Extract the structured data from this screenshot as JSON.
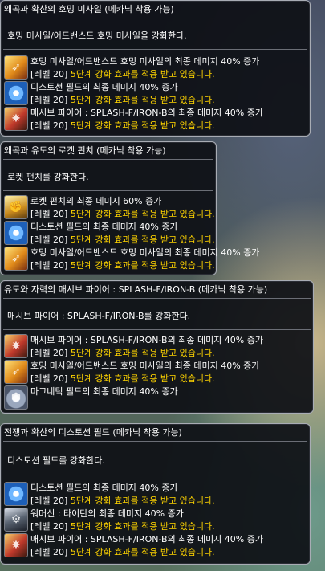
{
  "tooltips": [
    {
      "title": "왜곡과 확산의 호밍 미사일 (메카닉 착용 가능)",
      "desc": "호밍 미사일/어드밴스드 호밍 미사일을 강화한다.",
      "rows": [
        {
          "icon": "homing-missile-icon",
          "text": "호밍 미사일/어드밴스드 호밍 미사일의 최종 데미지 40% 증가",
          "level": "[레벨 20]",
          "note": " 5단계 강화 효과를 적용 받고 있습니다."
        },
        {
          "icon": "distortion-field-icon",
          "text": "디스토션 필드의 최종 데미지 40% 증가",
          "level": "[레벨 20]",
          "note": " 5단계 강화 효과를 적용 받고 있습니다."
        },
        {
          "icon": "massive-fire-icon",
          "text": "매시브 파이어 : SPLASH-F/IRON-B의 최종 데미지 40% 증가",
          "level": "[레벨 20]",
          "note": " 5단계 강화 효과를 적용 받고 있습니다."
        }
      ]
    },
    {
      "title": "왜곡과 유도의 로켓 펀치 (메카닉 착용 가능)",
      "desc": "로켓 펀치를 강화한다.",
      "rows": [
        {
          "icon": "rocket-punch-icon",
          "text": "로켓 펀치의 최종 데미지 60% 증가",
          "level": "[레벨 20]",
          "note": " 5단계 강화 효과를 적용 받고 있습니다."
        },
        {
          "icon": "distortion-field-icon",
          "text": "디스토션 필드의 최종 데미지 40% 증가",
          "level": "[레벨 20]",
          "note": " 5단계 강화 효과를 적용 받고 있습니다."
        },
        {
          "icon": "homing-missile-icon",
          "text": "호밍 미사일/어드밴스드 호밍 미사일의 최종 데미지 40% 증가",
          "level": "[레벨 20]",
          "note": " 5단계 강화 효과를 적용 받고 있습니다."
        }
      ]
    },
    {
      "title": "유도와 자력의 매시브 파이어 : SPLASH-F/IRON-B (메카닉 착용 가능)",
      "desc": "매시브 파이어 : SPLASH-F/IRON-B를 강화한다.",
      "rows": [
        {
          "icon": "massive-fire-icon",
          "text": "매시브 파이어 : SPLASH-F/IRON-B의 최종 데미지 40% 증가",
          "level": "[레벨 20]",
          "note": " 5단계 강화 효과를 적용 받고 있습니다."
        },
        {
          "icon": "homing-missile-icon",
          "text": "호밍 미사일/어드밴스드 호밍 미사일의 최종 데미지 40% 증가",
          "level": "[레벨 20]",
          "note": " 5단계 강화 효과를 적용 받고 있습니다."
        },
        {
          "icon": "magnetic-field-icon",
          "text": "마그네틱 필드의 최종 데미지 40% 증가",
          "level": "",
          "note": ""
        }
      ]
    },
    {
      "title": "전쟁과 확산의 디스토션 필드 (메카닉 착용 가능)",
      "desc": "디스토션 필드를 강화한다.",
      "rows": [
        {
          "icon": "distortion-field-icon",
          "text": "디스토션 필드의 최종 데미지 40% 증가",
          "level": "[레벨 20]",
          "note": " 5단계 강화 효과를 적용 받고 있습니다."
        },
        {
          "icon": "warmachine-titan-icon",
          "text": "워머신 : 타이탄의 최종 데미지 40% 증가",
          "level": "[레벨 20]",
          "note": " 5단계 강화 효과를 적용 받고 있습니다."
        },
        {
          "icon": "massive-fire-icon",
          "text": "매시브 파이어 : SPLASH-F/IRON-B의 최종 데미지 40% 증가",
          "level": "[레벨 20]",
          "note": " 5단계 강화 효과를 적용 받고 있습니다."
        }
      ]
    }
  ]
}
